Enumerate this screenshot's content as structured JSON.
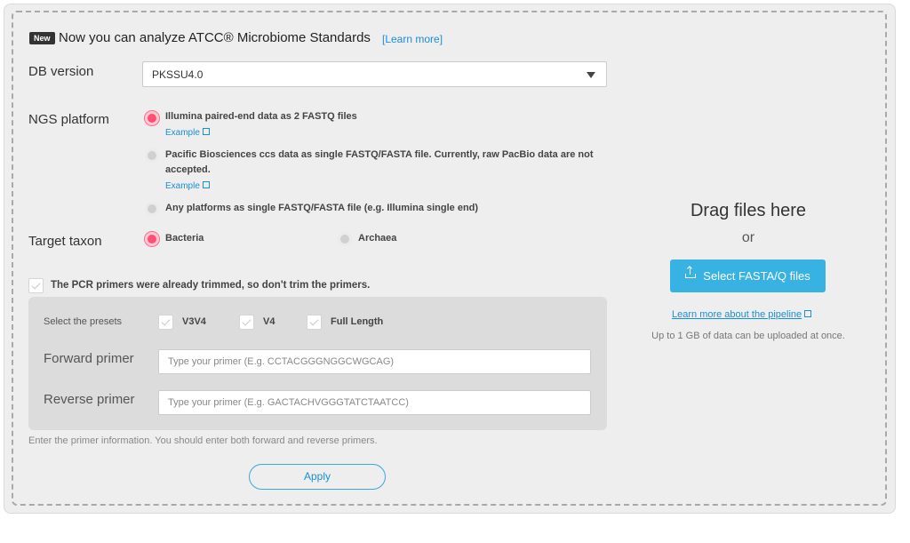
{
  "announcement": {
    "badge": "New",
    "text": "Now you can analyze ATCC® Microbiome Standards",
    "link": "[Learn more]"
  },
  "db_version": {
    "label": "DB version",
    "selected": "PKSSU4.0"
  },
  "ngs_platform": {
    "label": "NGS platform",
    "options": [
      {
        "text": "Illumina paired-end data as 2 FASTQ files",
        "example": "Example",
        "selected": true
      },
      {
        "text": "Pacific Biosciences ccs data as single FASTQ/FASTA file. Currently, raw PacBio data are not",
        "text2": "accepted.",
        "example": "Example",
        "selected": false
      },
      {
        "text": "Any platforms as single FASTQ/FASTA file (e.g. Illumina single end)",
        "selected": false
      }
    ]
  },
  "target_taxon": {
    "label": "Target taxon",
    "options": [
      {
        "text": "Bacteria",
        "selected": true
      },
      {
        "text": "Archaea",
        "selected": false
      }
    ]
  },
  "trim_checkbox": {
    "label": "The PCR primers were already trimmed, so don't trim the primers."
  },
  "presets": {
    "label": "Select the presets",
    "items": [
      "V3V4",
      "V4",
      "Full Length"
    ]
  },
  "forward_primer": {
    "label": "Forward primer",
    "placeholder": "Type your primer (E.g. CCTACGGGNGGCWGCAG)"
  },
  "reverse_primer": {
    "label": "Reverse primer",
    "placeholder": "Type your primer (E.g. GACTACHVGGGTATCTAATCC)"
  },
  "hint": "Enter the primer information. You should enter both forward and reverse primers.",
  "apply_label": "Apply",
  "upload": {
    "drag_text": "Drag files here",
    "or_text": "or",
    "button_label": "Select FASTA/Q files",
    "pipeline_link": "Learn more about the pipeline",
    "note": "Up to 1 GB of data can be uploaded at once."
  },
  "colors": {
    "accent": "#38b2e3",
    "link": "#1a8fd6",
    "radio_selected": "#ff4f75"
  }
}
